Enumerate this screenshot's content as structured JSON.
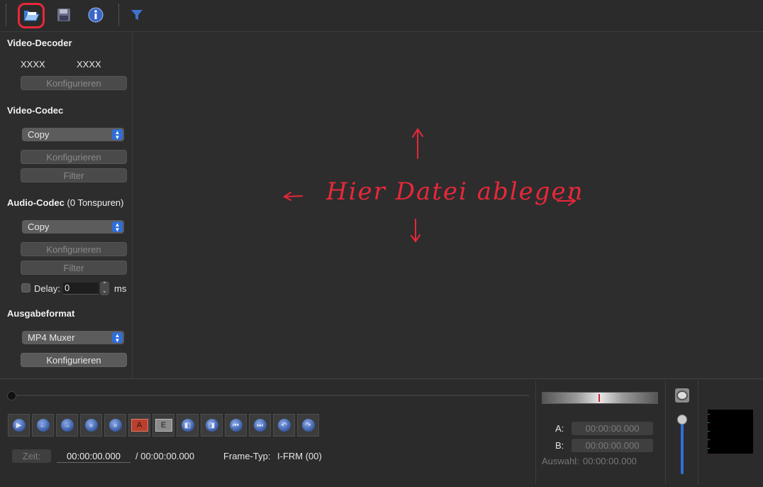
{
  "toolbar": {
    "open_icon": "folder-open-icon",
    "save_icon": "floppy-disk-icon",
    "info_icon": "info-icon",
    "filter_icon": "funnel-icon"
  },
  "left_panel": {
    "video_decoder": {
      "title": "Video-Decoder",
      "value_left": "XXXX",
      "value_right": "XXXX",
      "configure": "Konfigurieren"
    },
    "video_codec": {
      "title": "Video-Codec",
      "selected": "Copy",
      "configure": "Konfigurieren",
      "filter": "Filter"
    },
    "audio_codec": {
      "title": "Audio-Codec",
      "tracks": "(0 Tonspuren)",
      "selected": "Copy",
      "configure": "Konfigurieren",
      "filter": "Filter",
      "delay_label": "Delay:",
      "delay_value": "0",
      "delay_unit": "ms"
    },
    "output_format": {
      "title": "Ausgabeformat",
      "selected": "MP4 Muxer",
      "configure": "Konfigurieren"
    }
  },
  "drop_zone": {
    "hint": "Hier Datei ablegen"
  },
  "bottom": {
    "time_label": "Zeit:",
    "time_value": "00:00:00.000",
    "duration": "/ 00:00:00.000",
    "frame_type_label": "Frame-Typ:",
    "frame_type_value": "I-FRM (00)",
    "marker_a_label": "A:",
    "marker_a_value": "00:00:00.000",
    "marker_b_label": "B:",
    "marker_b_value": "00:00:00.000",
    "selection_label": "Auswahl:",
    "selection_value": "00:00:00.000",
    "nav_icons": [
      "play-icon",
      "prev-frame-icon",
      "next-frame-icon",
      "prev-keyframe-icon",
      "next-keyframe-icon",
      "set-marker-a-icon",
      "set-marker-b-icon",
      "goto-marker-a-icon",
      "goto-marker-b-icon",
      "goto-start-icon",
      "goto-end-icon",
      "back-60-icon",
      "forward-60-icon"
    ],
    "volume_level": 0.85
  },
  "colors": {
    "accent": "#2f6ed9",
    "annotation": "#e8283a"
  }
}
